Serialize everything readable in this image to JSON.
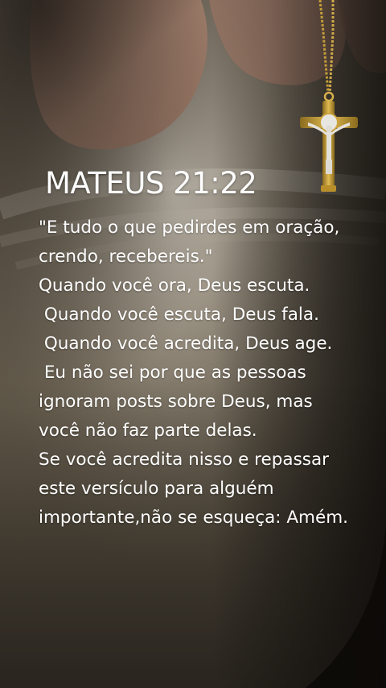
{
  "background": {
    "description_colors": {
      "base": "#5c5346",
      "page_light": "#bfb7aa",
      "hand": "#c79a83",
      "gold": "#c9a23a",
      "shadow": "#0f0d0b"
    }
  },
  "verse": {
    "reference": "MATEUS 21:22",
    "lines": [
      "\"E tudo o que pedirdes em oração,",
      "crendo, recebereis.\"",
      "Quando você ora, Deus escuta.",
      " Quando você escuta, Deus fala.",
      " Quando você acredita, Deus age.",
      " Eu não sei por que as pessoas",
      "ignoram posts sobre Deus, mas",
      "você não faz parte delas.",
      "Se você acredita nisso e repassar",
      "este versículo para alguém",
      "importante,não se esqueça: Amém."
    ]
  }
}
